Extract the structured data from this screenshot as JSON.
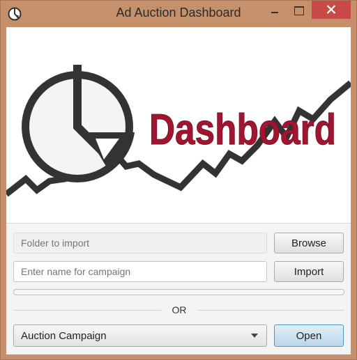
{
  "window": {
    "title": "Ad Auction Dashboard",
    "icon": "pie-chart-icon"
  },
  "banner": {
    "logo_text": "Dashboard",
    "logo_color": "#a01530",
    "icon": "pie-chart-icon"
  },
  "import_section": {
    "folder_placeholder": "Folder to import",
    "browse_label": "Browse",
    "campaign_name_placeholder": "Enter name for campaign",
    "import_label": "Import",
    "progress": 0
  },
  "divider": {
    "label": "OR"
  },
  "open_section": {
    "selected_campaign": "Auction Campaign",
    "open_label": "Open"
  },
  "colors": {
    "frame": "#c6906a",
    "close_button": "#c74a46",
    "accent": "#4a98c9"
  }
}
